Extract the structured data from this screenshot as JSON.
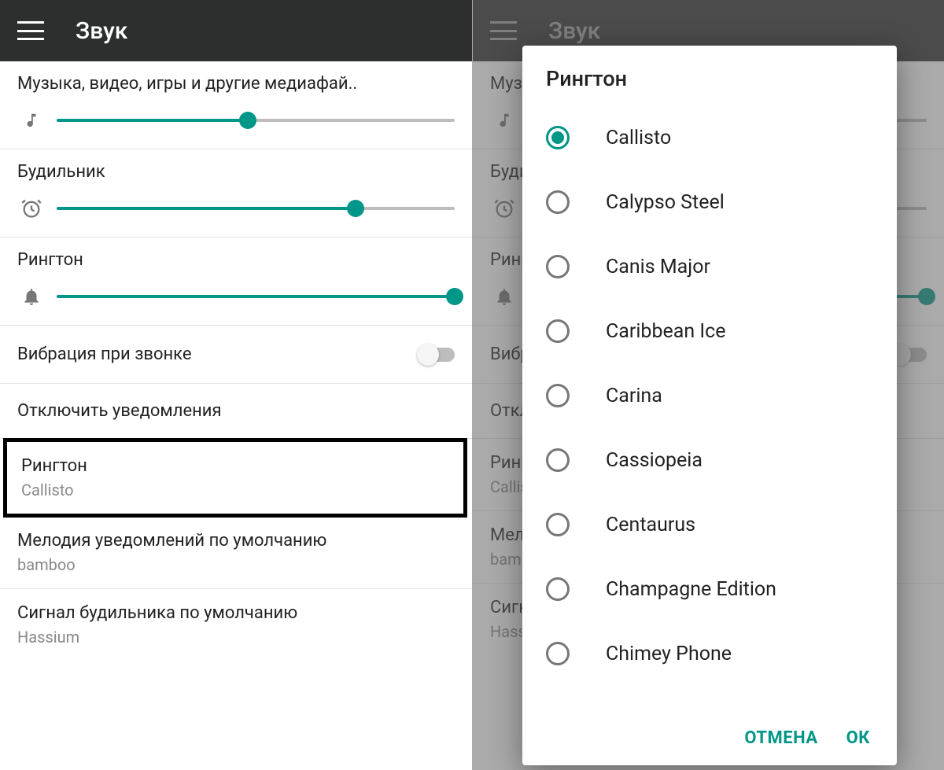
{
  "colors": {
    "accent": "#009688"
  },
  "header": {
    "title": "Звук"
  },
  "sliders": {
    "media": {
      "label": "Музыка, видео, игры и другие медиафай..",
      "percent": 48
    },
    "alarm": {
      "label": "Будильник",
      "percent": 75
    },
    "ringtone": {
      "label": "Рингтон",
      "percent": 100
    }
  },
  "vibrate": {
    "label": "Вибрация при звонке",
    "on": false
  },
  "mute_notifications": {
    "label": "Отключить уведомления"
  },
  "ringtone_setting": {
    "label": "Рингтон",
    "value": "Callisto"
  },
  "notification_sound": {
    "label": "Мелодия уведомлений по умолчанию",
    "value": "bamboo"
  },
  "alarm_sound": {
    "label": "Сигнал будильника по умолчанию",
    "value": "Hassium"
  },
  "dialog": {
    "title": "Рингтон",
    "selected_index": 0,
    "options": [
      "Callisto",
      "Calypso Steel",
      "Canis Major",
      "Caribbean Ice",
      "Carina",
      "Cassiopeia",
      "Centaurus",
      "Champagne Edition",
      "Chimey Phone"
    ],
    "cancel": "ОТМЕНА",
    "ok": "ОК"
  }
}
